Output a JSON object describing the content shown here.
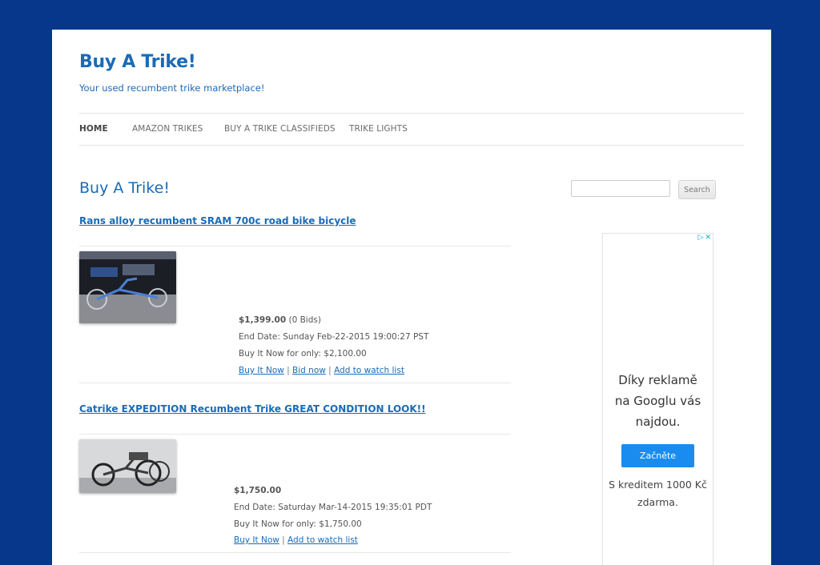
{
  "site": {
    "title": "Buy A Trike!",
    "description": "Your used recumbent trike marketplace!"
  },
  "nav": [
    {
      "label": "HOME",
      "current": true
    },
    {
      "label": "AMAZON TRIKES"
    },
    {
      "label": "BUY A TRIKE CLASSIFIEDS"
    },
    {
      "label": "TRIKE LIGHTS"
    }
  ],
  "main": {
    "heading": "Buy A Trike!",
    "items": [
      {
        "title": "Rans alloy recumbent SRAM 700c road bike bicycle",
        "price": "$1,399.00",
        "bids": "(0 Bids)",
        "end_date": "End Date: Sunday Feb-22-2015 19:00:27 PST",
        "buy_now": "Buy It Now for only: $2,100.00",
        "links": [
          "Buy It Now",
          "Bid now",
          "Add to watch list"
        ]
      },
      {
        "title": "Catrike EXPEDITION Recumbent Trike GREAT CONDITION LOOK!!",
        "price": "$1,750.00",
        "bids": "",
        "end_date": "End Date: Saturday Mar-14-2015 19:35:01 PDT",
        "buy_now": "Buy It Now for only: $1,750.00",
        "links": [
          "Buy It Now",
          "Add to watch list"
        ]
      }
    ]
  },
  "sidebar": {
    "search_button": "Search",
    "search_value": "",
    "ad": {
      "text_lines": [
        "Díky reklamě",
        "na Googlu vás",
        "najdou."
      ],
      "button": "Začněte",
      "sub_lines": [
        "S kreditem 1000 Kč",
        "zdarma."
      ],
      "badge_icons": [
        "adchoices-icon",
        "close-icon"
      ]
    }
  },
  "colors": {
    "background": "#06378a",
    "accent": "#1a6bb8",
    "ad_button": "#1a8cf0"
  }
}
